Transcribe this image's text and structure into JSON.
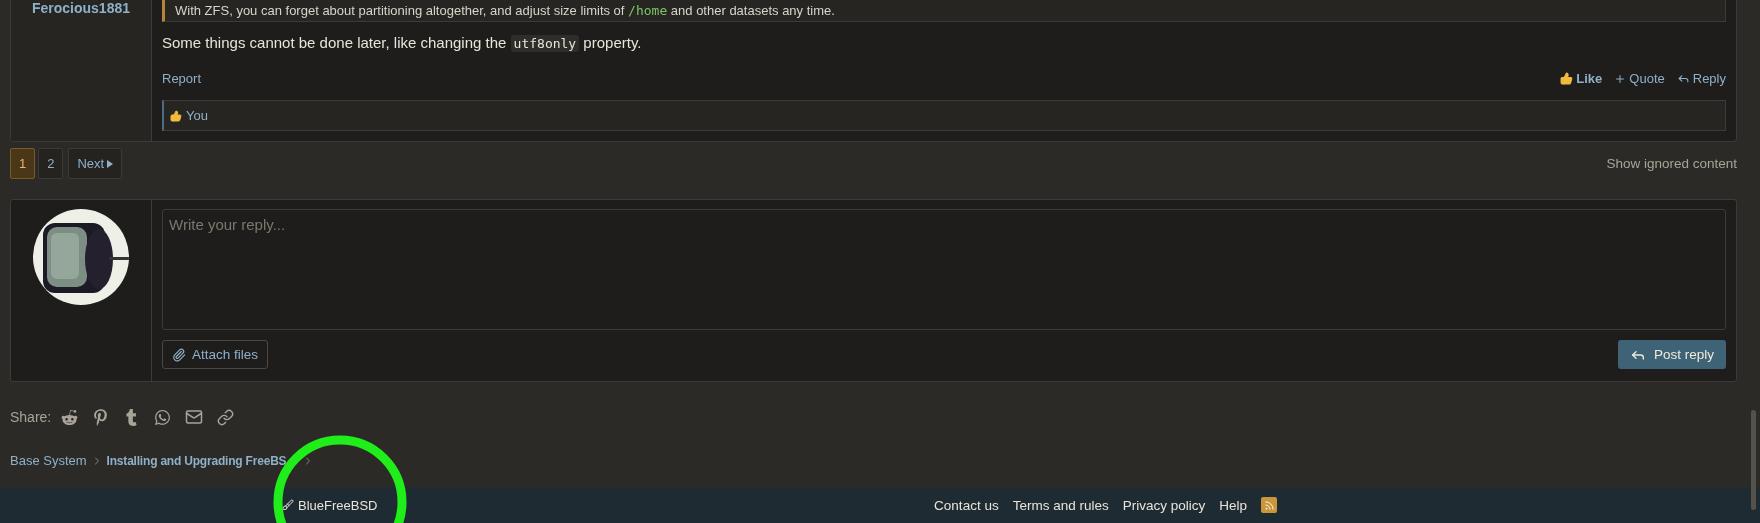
{
  "post": {
    "author": "Ferocious1881",
    "quote": [
      {
        "kind": "text",
        "text": "With ZFS, you can forget about partitioning altogether, and adjust size limits of "
      },
      {
        "kind": "code",
        "text": "/home"
      },
      {
        "kind": "text",
        "text": " and other datasets any time."
      }
    ],
    "body": [
      {
        "kind": "text",
        "text": "Some things cannot be done later, like changing the "
      },
      {
        "kind": "code",
        "text": "utf8only"
      },
      {
        "kind": "text",
        "text": " property."
      }
    ],
    "report": "Report",
    "actions": [
      {
        "kind": "like",
        "label": "Like"
      },
      {
        "kind": "quote",
        "label": "Quote"
      },
      {
        "kind": "reply",
        "label": "Reply"
      }
    ],
    "reactions": "You"
  },
  "pagination": {
    "pages": [
      {
        "label": "1",
        "selected": true
      },
      {
        "label": "2",
        "selected": false
      }
    ],
    "next": "Next"
  },
  "show_ignored": "Show ignored content",
  "reply": {
    "placeholder": "Write your reply...",
    "attach": "Attach files",
    "submit": "Post reply"
  },
  "share": {
    "label": "Share:",
    "icons": [
      {
        "kind": "reddit"
      },
      {
        "kind": "pinterest"
      },
      {
        "kind": "tumblr"
      },
      {
        "kind": "whatsapp"
      },
      {
        "kind": "mail"
      },
      {
        "kind": "link"
      }
    ]
  },
  "breadcrumb": [
    {
      "label": "Base System",
      "bold": false
    },
    {
      "label": "Installing and Upgrading FreeBS",
      "bold": true
    }
  ],
  "footer": {
    "style": "BlueFreeBSD",
    "links": [
      "Contact us",
      "Terms and rules",
      "Privacy policy",
      "Help"
    ]
  }
}
